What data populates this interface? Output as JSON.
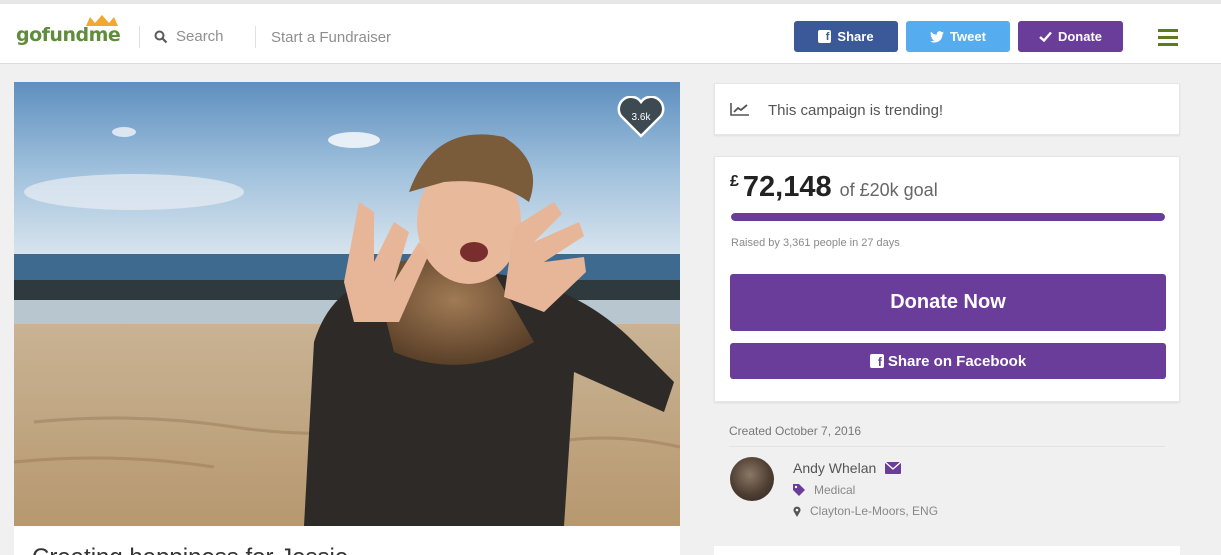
{
  "header": {
    "logo": {
      "part1": "go",
      "part2": "fund",
      "part3": "me"
    },
    "search_label": "Search",
    "start_fundraiser_label": "Start a Fundraiser",
    "share_label": "Share",
    "tweet_label": "Tweet",
    "donate_label": "Donate",
    "icons": [
      "gofundme-crown-icon",
      "search-icon",
      "facebook-icon",
      "twitter-icon",
      "check-icon",
      "hamburger-menu-icon"
    ]
  },
  "campaign": {
    "likes": "3.6k",
    "title_partial": "Creating happiness for Jessie..."
  },
  "trending": {
    "text": "This campaign is trending!",
    "icon": "trending-icon"
  },
  "goal": {
    "currency": "£",
    "amount": "72,148",
    "goal_text": "of £20k goal",
    "progress_fraction": 1.0,
    "raised_text": "Raised by 3,361 people in 27 days",
    "donate_now_label": "Donate Now",
    "share_facebook_label": "Share on Facebook"
  },
  "organizer": {
    "created": "Created October 7, 2016",
    "name": "Andy Whelan",
    "category": "Medical",
    "location": "Clayton-Le-Moors, ENG",
    "icons": [
      "mail-icon",
      "tag-icon",
      "location-pin-icon"
    ]
  },
  "colors": {
    "purple": "#6a3d9a",
    "facebook": "#3b5998",
    "twitter": "#55acee",
    "logo_green": "#5f8d3b"
  }
}
